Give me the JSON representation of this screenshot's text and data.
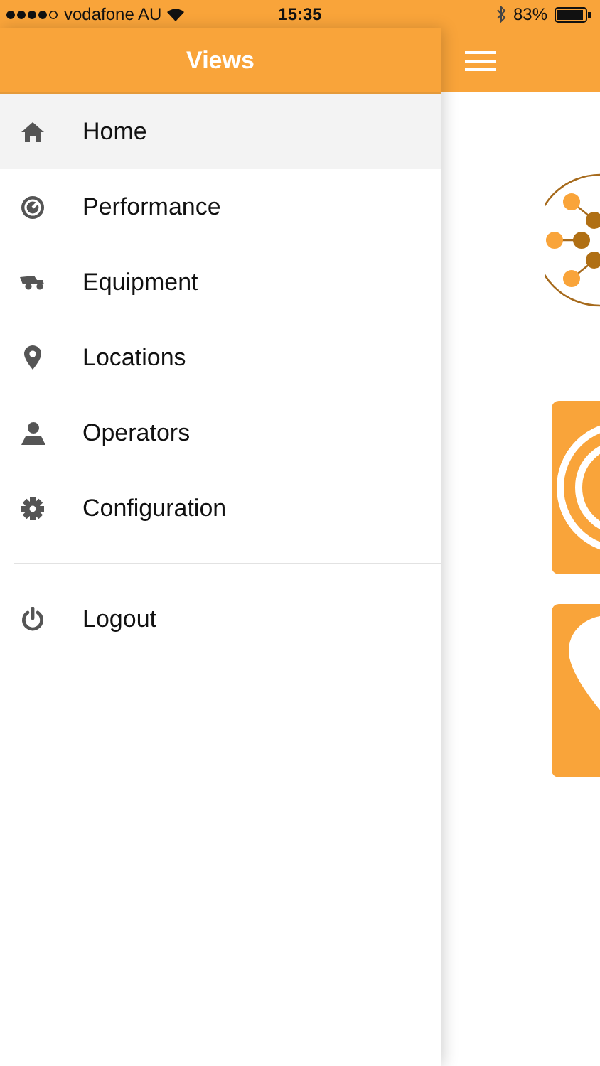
{
  "status_bar": {
    "carrier": "vodafone AU",
    "time": "15:35",
    "battery": "83%"
  },
  "drawer": {
    "title": "Views",
    "items": [
      {
        "label": "Home",
        "selected": true
      },
      {
        "label": "Performance",
        "selected": false
      },
      {
        "label": "Equipment",
        "selected": false
      },
      {
        "label": "Locations",
        "selected": false
      },
      {
        "label": "Operators",
        "selected": false
      },
      {
        "label": "Configuration",
        "selected": false
      }
    ],
    "footer_items": [
      {
        "label": "Logout",
        "selected": false
      }
    ]
  }
}
